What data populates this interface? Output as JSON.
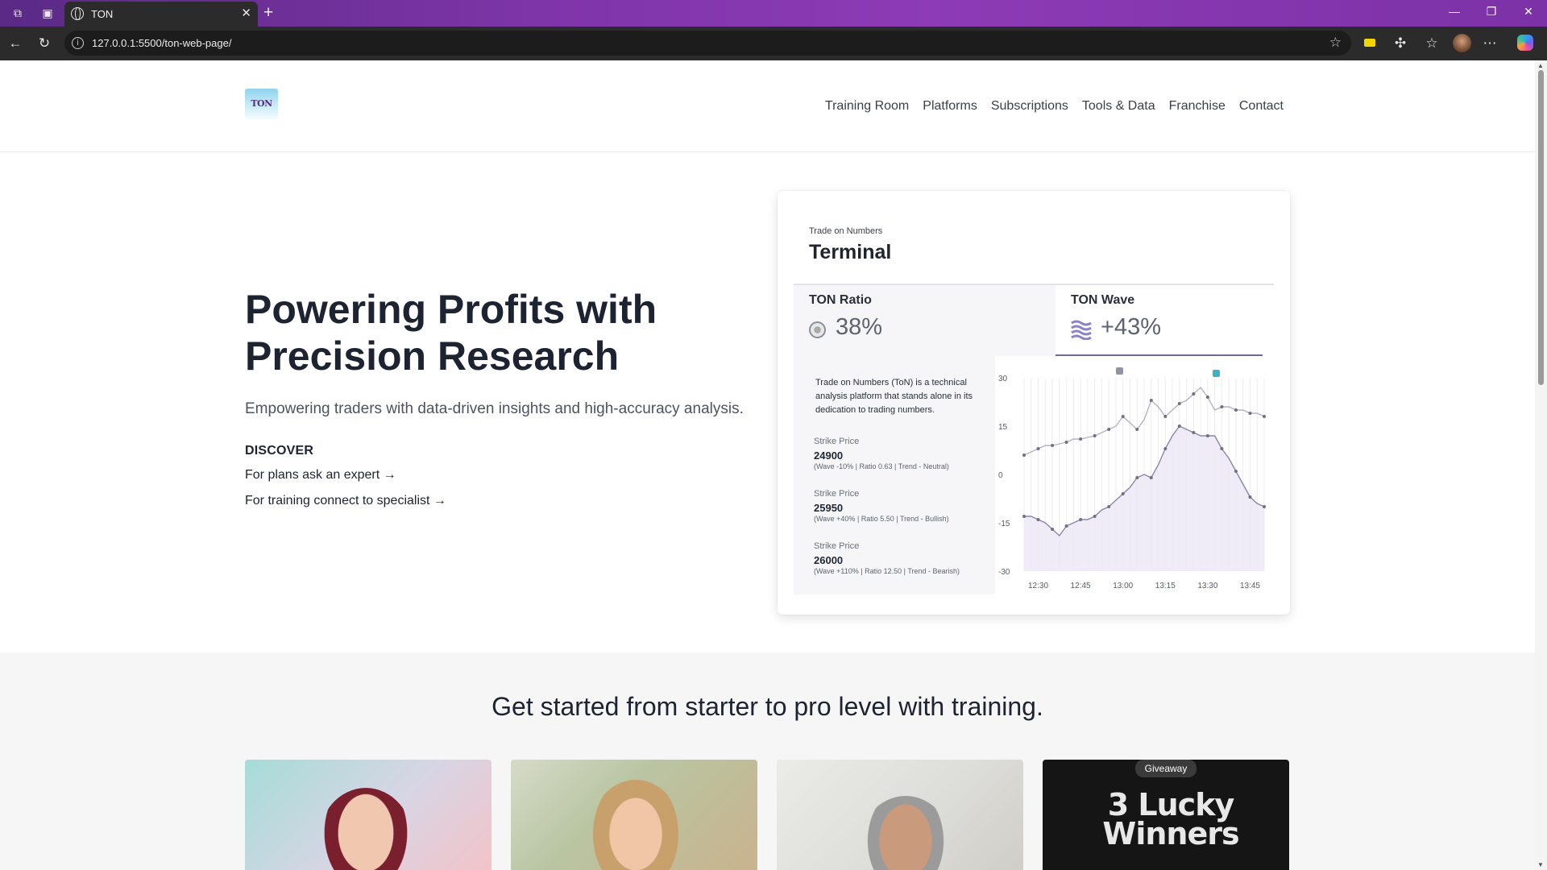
{
  "browser": {
    "tab_title": "TON",
    "url": "127.0.0.1:5500/ton-web-page/"
  },
  "site": {
    "logo_text": "TON",
    "nav": [
      "Training Room",
      "Platforms",
      "Subscriptions",
      "Tools & Data",
      "Franchise",
      "Contact"
    ]
  },
  "hero": {
    "title": "Powering Profits with Precision Research",
    "subtitle": "Empowering traders with data-driven insights and high-accuracy analysis.",
    "discover_label": "DISCOVER",
    "link_plans": "For plans ask an expert →",
    "link_training": "For training connect to specialist →"
  },
  "terminal": {
    "eyebrow": "Trade on Numbers",
    "title": "Terminal",
    "ratio_label": "TON Ratio",
    "ratio_value": "38%",
    "wave_label": "TON Wave",
    "wave_value": "+43%",
    "description": "Trade on Numbers (ToN) is a technical analysis platform that stands alone in its dedication to trading numbers.",
    "strikes": [
      {
        "label": "Strike Price",
        "value": "24900",
        "meta": "(Wave -10% | Ratio 0.63 | Trend - Neutral)"
      },
      {
        "label": "Strike Price",
        "value": "25950",
        "meta": "(Wave +40% | Ratio 5.50 | Trend - Bullish)"
      },
      {
        "label": "Strike Price",
        "value": "26000",
        "meta": "(Wave +110% | Ratio 12.50 | Trend - Bearish)"
      }
    ]
  },
  "chart_data": {
    "type": "line",
    "x": [
      "12:25",
      "12:27",
      "12:30",
      "12:32",
      "12:35",
      "12:37",
      "12:40",
      "12:42",
      "12:45",
      "12:47",
      "12:50",
      "12:52",
      "12:55",
      "12:57",
      "13:00",
      "13:02",
      "13:05",
      "13:07",
      "13:10",
      "13:12",
      "13:15",
      "13:17",
      "13:20",
      "13:22",
      "13:25",
      "13:27",
      "13:30",
      "13:32",
      "13:35",
      "13:37",
      "13:40",
      "13:42",
      "13:45",
      "13:47",
      "13:50"
    ],
    "series": [
      {
        "values": [
          6,
          7,
          8,
          9,
          9,
          9.5,
          10,
          11,
          11,
          11.5,
          12,
          13,
          14,
          15,
          18,
          16,
          14,
          17,
          23,
          21,
          18,
          20,
          22,
          23,
          25,
          27,
          24,
          20,
          21,
          21,
          20,
          20,
          19,
          19,
          18
        ]
      },
      {
        "values": [
          -13,
          -13,
          -14,
          -15,
          -17,
          -19,
          -16,
          -15,
          -14,
          -14,
          -13,
          -11,
          -10,
          -8,
          -6,
          -4,
          -1,
          0,
          -1,
          3,
          8,
          12,
          15,
          14,
          13,
          12,
          12,
          12,
          8,
          5,
          1,
          -3,
          -7,
          -9,
          -10
        ]
      }
    ],
    "xticks": [
      "12:30",
      "12:45",
      "13:00",
      "13:15",
      "13:30",
      "13:45"
    ],
    "yticks": [
      30,
      15,
      0,
      -15,
      -30
    ],
    "ylim": [
      -30,
      30
    ]
  },
  "training": {
    "heading": "Get started from starter to pro level with training.",
    "giveaway_badge": "Giveaway",
    "giveaway_title": "3 Lucky Winners"
  }
}
